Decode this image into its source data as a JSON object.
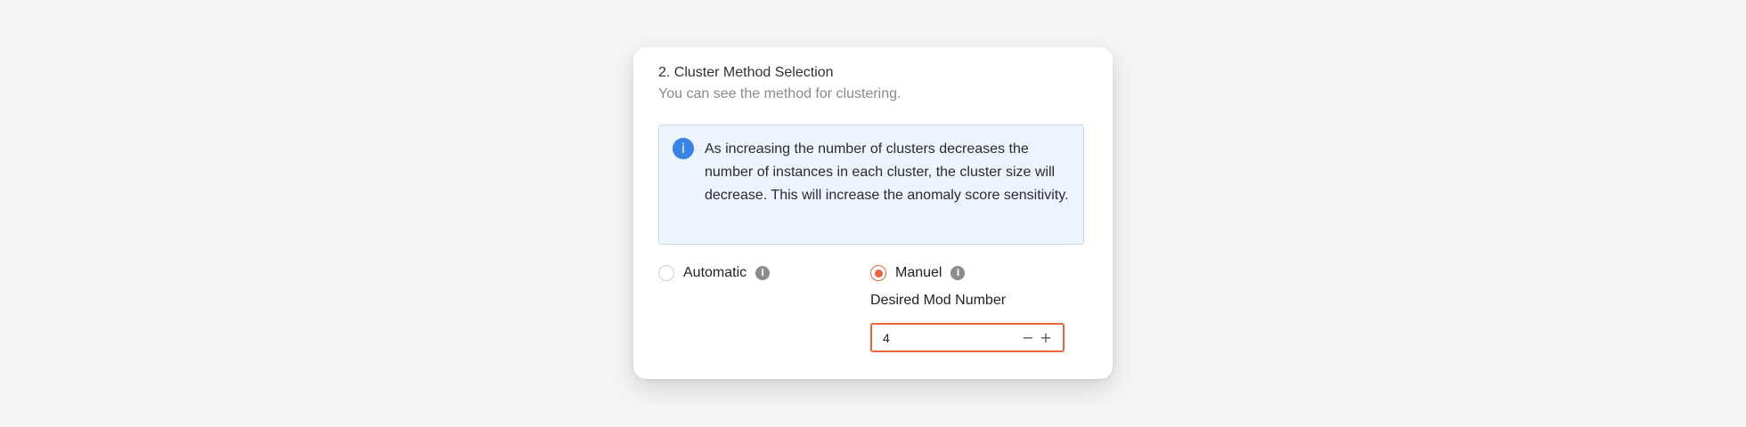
{
  "section": {
    "title": "2. Cluster Method Selection",
    "subtitle": "You can see the method for clustering."
  },
  "info": {
    "icon": "info-icon",
    "icon_glyph": "i",
    "text": "As increasing the number of clusters decreases the number of instances in each cluster, the cluster size will decrease. This will increase the anomaly score sensitivity."
  },
  "methods": {
    "automatic": {
      "label": "Automatic",
      "selected": false,
      "help_glyph": "i"
    },
    "manual": {
      "label": "Manuel",
      "selected": true,
      "help_glyph": "i"
    }
  },
  "mod_number": {
    "label": "Desired Mod Number",
    "value": "4",
    "minus_glyph": "−",
    "plus_glyph": "+"
  },
  "colors": {
    "accent": "#e8663a",
    "info_blue": "#3a83e6",
    "info_bg": "#edf4fd"
  }
}
